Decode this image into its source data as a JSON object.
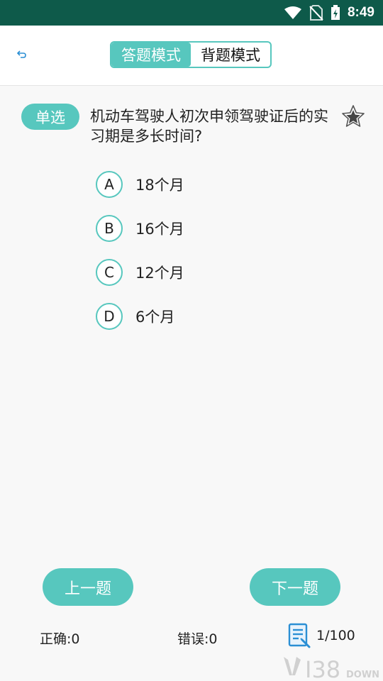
{
  "status_bar": {
    "time": "8:49"
  },
  "header": {
    "back_icon": "back-arrow-icon",
    "tabs": [
      {
        "label": "答题模式",
        "active": true
      },
      {
        "label": "背题模式",
        "active": false
      }
    ]
  },
  "question": {
    "type": "单选",
    "text": "机动车驾驶人初次申领驾驶证后的实习期是多长时间?",
    "favorite_icon": "star-icon",
    "options": [
      {
        "letter": "A",
        "text": "18个月"
      },
      {
        "letter": "B",
        "text": "16个月"
      },
      {
        "letter": "C",
        "text": "12个月"
      },
      {
        "letter": "D",
        "text": "6个月"
      }
    ]
  },
  "nav": {
    "prev_label": "上一题",
    "next_label": "下一题"
  },
  "stats": {
    "correct": "正确:0",
    "wrong": "错误:0",
    "progress": "1/100",
    "progress_icon": "answer-sheet-icon"
  },
  "watermark": {
    "text": "138DOWN"
  },
  "colors": {
    "accent": "#57c7be",
    "status_bar": "#0e5a4a",
    "icon_blue": "#2b8fd4"
  }
}
